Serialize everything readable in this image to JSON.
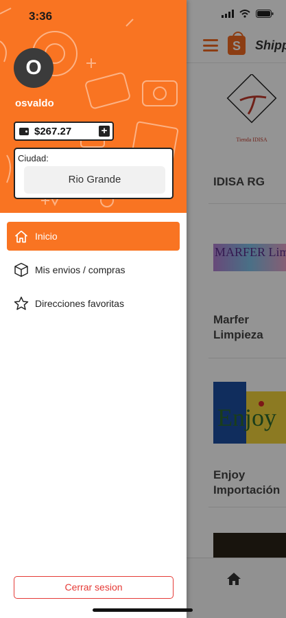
{
  "status_bar": {
    "time": "3:36"
  },
  "drawer": {
    "avatar_initial": "O",
    "username": "osvaldo",
    "balance": "$267.27",
    "city_label": "Ciudad:",
    "city_value": "Rio Grande",
    "menu": [
      {
        "label": "Inicio",
        "icon": "home-icon",
        "active": true
      },
      {
        "label": "Mis envios / compras",
        "icon": "box-icon",
        "active": false
      },
      {
        "label": "Direcciones favoritas",
        "icon": "star-icon",
        "active": false
      }
    ],
    "logout_label": "Cerrar sesion"
  },
  "main": {
    "app_title": "Shipp",
    "stores": [
      {
        "name": "IDISA RG",
        "logo_text": "Tienda IDISA"
      },
      {
        "name": "Marfer Limpieza",
        "logo_text": "MARFER Limpieza"
      },
      {
        "name": "Enjoy Importación",
        "logo_text": "Enjoy"
      }
    ]
  },
  "colors": {
    "accent": "#f97422",
    "logout": "#e53935",
    "dark": "#222222"
  }
}
